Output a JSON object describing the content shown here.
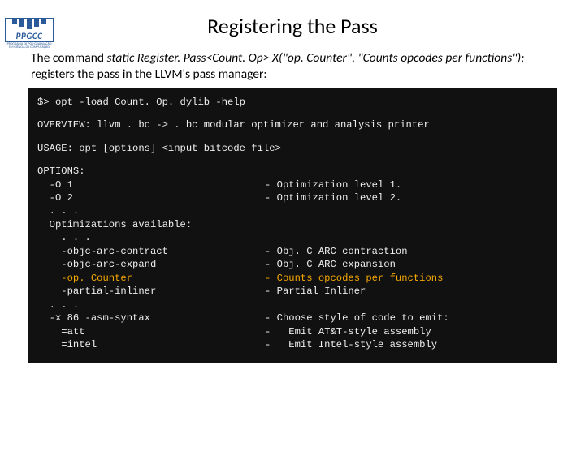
{
  "logo": {
    "acronym": "PPGCC",
    "subtitle": "PROGRAMA DE PÓS-GRADUAÇÃO EM CIÊNCIA DA COMPUTAÇÃO"
  },
  "title": "Registering the Pass",
  "intro": {
    "lead": "The command ",
    "code": "static Register. Pass<Count. Op> X(\"op. Counter\", \"Counts opcodes per functions\");",
    "trail": " registers the pass in the LLVM's pass manager:"
  },
  "terminal": {
    "cmd": "$> opt -load Count. Op. dylib -help",
    "overview": "OVERVIEW: llvm . bc -> . bc modular optimizer and analysis printer",
    "usage": "USAGE: opt [options] <input bitcode file>",
    "options_header": "OPTIONS:",
    "rows": [
      {
        "left": "  -O 1",
        "right": "- Optimization level 1."
      },
      {
        "left": "  -O 2",
        "right": "- Optimization level 2."
      },
      {
        "left": "  . . .",
        "right": ""
      },
      {
        "left": "  Optimizations available:",
        "right": ""
      },
      {
        "left": "    . . .",
        "right": ""
      },
      {
        "left": "    -objc-arc-contract",
        "right": "- Obj. C ARC contraction"
      },
      {
        "left": "    -objc-arc-expand",
        "right": "- Obj. C ARC expansion"
      },
      {
        "left": "    -op. Counter",
        "right": "- Counts opcodes per functions",
        "hl": true
      },
      {
        "left": "    -partial-inliner",
        "right": "- Partial Inliner"
      },
      {
        "left": "  . . .",
        "right": ""
      },
      {
        "left": "  -x 86 -asm-syntax",
        "right": "- Choose style of code to emit:"
      },
      {
        "left": "    =att",
        "right": "-   Emit AT&T-style assembly"
      },
      {
        "left": "    =intel",
        "right": "-   Emit Intel-style assembly"
      }
    ]
  }
}
